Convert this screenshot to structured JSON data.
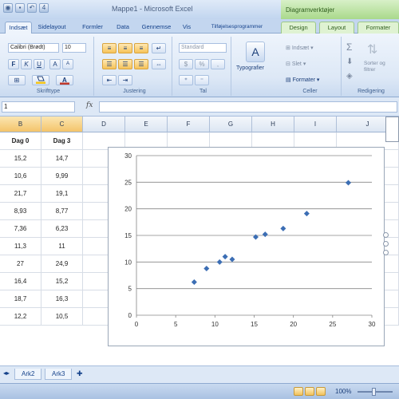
{
  "window": {
    "title": "Mappe1 - Microsoft Excel",
    "context_title": "Diagramverktøjer",
    "qat_label": "4"
  },
  "tabs": [
    {
      "label": "Indsæt",
      "active": true
    },
    {
      "label": "Sidelayout"
    },
    {
      "label": "Formler"
    },
    {
      "label": "Data"
    },
    {
      "label": "Gennemse"
    },
    {
      "label": "Vis"
    },
    {
      "label": "Tilføjelsesprogrammer"
    },
    {
      "label": "Design",
      "context": true
    },
    {
      "label": "Layout",
      "context": true
    },
    {
      "label": "Formater",
      "context": true
    }
  ],
  "ribbon": {
    "font_name": "Calibri (Brødt)",
    "font_size": "10",
    "number_format": "Standard",
    "styles_label": "Typografier",
    "insert_label": "Indsæt",
    "delete_label": "Slet",
    "format_label": "Formater",
    "sort_filter_label": "Sorter og filtrer",
    "groups": {
      "font": "Skrifttype",
      "alignment": "Justering",
      "number": "Tal",
      "cells": "Celler",
      "editing": "Redigering"
    },
    "colors": {
      "fill": "#f5c518",
      "font": "#c0392b"
    }
  },
  "formula_bar": {
    "name_box": "1",
    "fx": "fx",
    "value": ""
  },
  "grid": {
    "columns": [
      "B",
      "C",
      "D",
      "E",
      "F",
      "G",
      "H",
      "I",
      "J"
    ],
    "selected_columns": [
      "B",
      "C"
    ],
    "headers": [
      "Dag 0",
      "Dag 3"
    ],
    "rows": [
      [
        "15,2",
        "14,7"
      ],
      [
        "10,6",
        "9,99"
      ],
      [
        "21,7",
        "19,1"
      ],
      [
        "8,93",
        "8,77"
      ],
      [
        "7,36",
        "6,23"
      ],
      [
        "11,3",
        "11"
      ],
      [
        "27",
        "24,9"
      ],
      [
        "16,4",
        "15,2"
      ],
      [
        "18,7",
        "16,3"
      ],
      [
        "12,2",
        "10,5"
      ]
    ]
  },
  "chart_data": {
    "type": "scatter",
    "x": [
      15.2,
      10.6,
      21.7,
      8.93,
      7.36,
      11.3,
      27,
      16.4,
      18.7,
      12.2
    ],
    "y": [
      14.7,
      9.99,
      19.1,
      8.77,
      6.23,
      11,
      24.9,
      15.2,
      16.3,
      10.5
    ],
    "xlim": [
      0,
      30
    ],
    "ylim": [
      0,
      30
    ],
    "xticks": [
      0,
      5,
      10,
      15,
      20,
      25,
      30
    ],
    "yticks": [
      0,
      5,
      10,
      15,
      20,
      25,
      30
    ],
    "grid": "horizontal",
    "marker_color": "#3c6eb4",
    "title": "",
    "xlabel": "",
    "ylabel": ""
  },
  "sheets": [
    {
      "label": "Ark2"
    },
    {
      "label": "Ark3"
    }
  ],
  "status": {
    "zoom": "100%"
  }
}
